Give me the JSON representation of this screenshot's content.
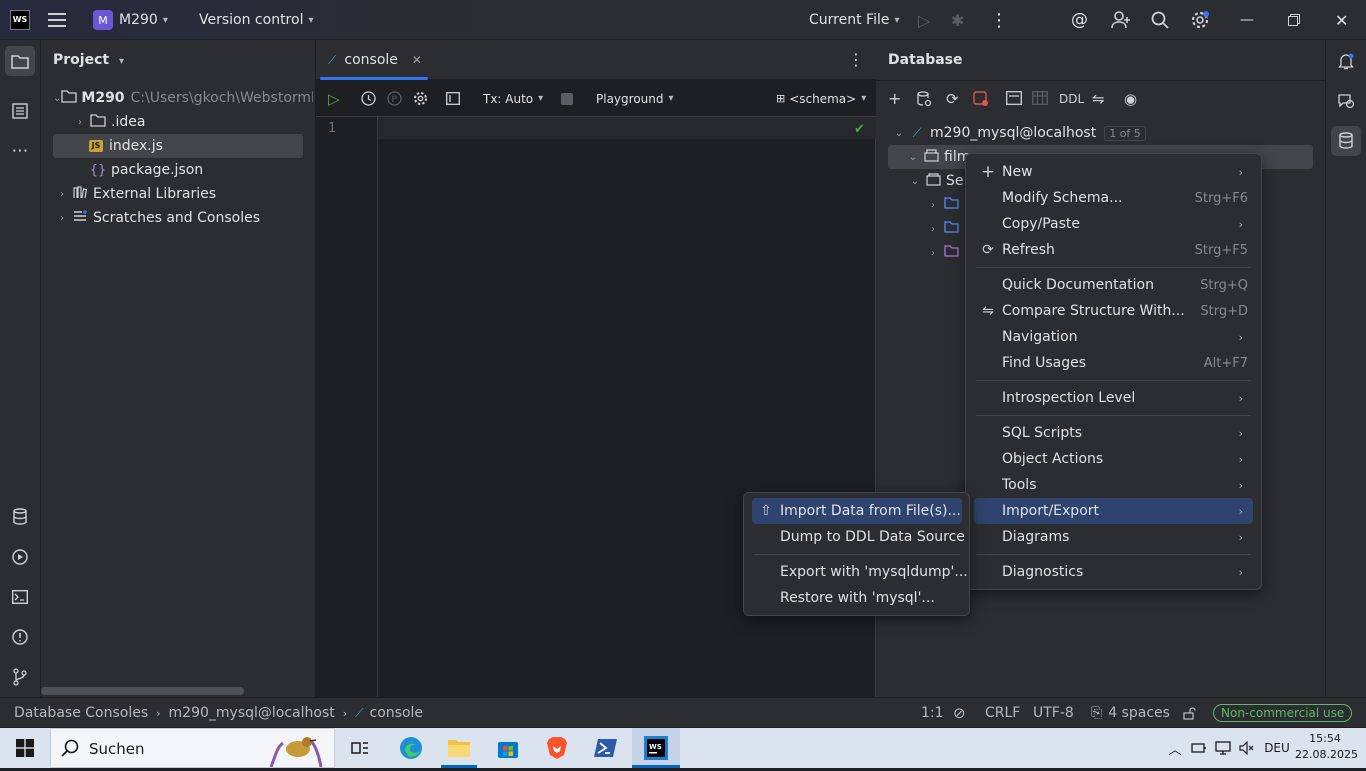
{
  "titlebar": {
    "logo": "WS",
    "project_badge": "M",
    "project_name": "M290",
    "vcs": "Version control",
    "run_config": "Current File"
  },
  "project_panel": {
    "title": "Project",
    "tree": [
      {
        "label": "M290",
        "path": "C:\\Users\\gkoch\\WebstormPr"
      },
      {
        "label": ".idea"
      },
      {
        "label": "index.js"
      },
      {
        "label": "package.json"
      },
      {
        "label": "External Libraries"
      },
      {
        "label": "Scratches and Consoles"
      }
    ]
  },
  "editor": {
    "tab_label": "console",
    "tx_mode": "Tx: Auto",
    "mode": "Playground",
    "schema": "<schema>",
    "line_number": "1"
  },
  "database_panel": {
    "title": "Database",
    "ddl_label": "DDL",
    "datasource": "m290_mysql@localhost",
    "datasource_count": "1 of 5",
    "node_schema": "film",
    "node_server": "Se"
  },
  "context_menu": {
    "items": [
      {
        "label": "New",
        "shortcut": ""
      },
      {
        "label": "Modify Schema...",
        "shortcut": "Strg+F6"
      },
      {
        "label": "Copy/Paste",
        "shortcut": ""
      },
      {
        "label": "Refresh",
        "shortcut": "Strg+F5"
      },
      {
        "label": "Quick Documentation",
        "shortcut": "Strg+Q"
      },
      {
        "label": "Compare Structure With...",
        "shortcut": "Strg+D"
      },
      {
        "label": "Navigation",
        "shortcut": ""
      },
      {
        "label": "Find Usages",
        "shortcut": "Alt+F7"
      },
      {
        "label": "Introspection Level",
        "shortcut": ""
      },
      {
        "label": "SQL Scripts",
        "shortcut": ""
      },
      {
        "label": "Object Actions",
        "shortcut": ""
      },
      {
        "label": "Tools",
        "shortcut": ""
      },
      {
        "label": "Import/Export",
        "shortcut": ""
      },
      {
        "label": "Diagrams",
        "shortcut": ""
      },
      {
        "label": "Diagnostics",
        "shortcut": ""
      }
    ]
  },
  "submenu": {
    "items": [
      {
        "label": "Import Data from File(s)..."
      },
      {
        "label": "Dump to DDL Data Source"
      },
      {
        "label": "Export with 'mysqldump'..."
      },
      {
        "label": "Restore with 'mysql'..."
      }
    ]
  },
  "statusbar": {
    "crumb1": "Database Consoles",
    "crumb2": "m290_mysql@localhost",
    "crumb3": "console",
    "position": "1:1",
    "line_sep": "CRLF",
    "encoding": "UTF-8",
    "indent": "4 spaces",
    "license": "Non-commercial use"
  },
  "taskbar": {
    "search_placeholder": "Suchen",
    "lang": "DEU",
    "time": "15:54",
    "date": "22.08.2025"
  },
  "colors": {
    "accent": "#3574f0",
    "menu_highlight": "#2e436e",
    "license_green": "#5fb865"
  }
}
